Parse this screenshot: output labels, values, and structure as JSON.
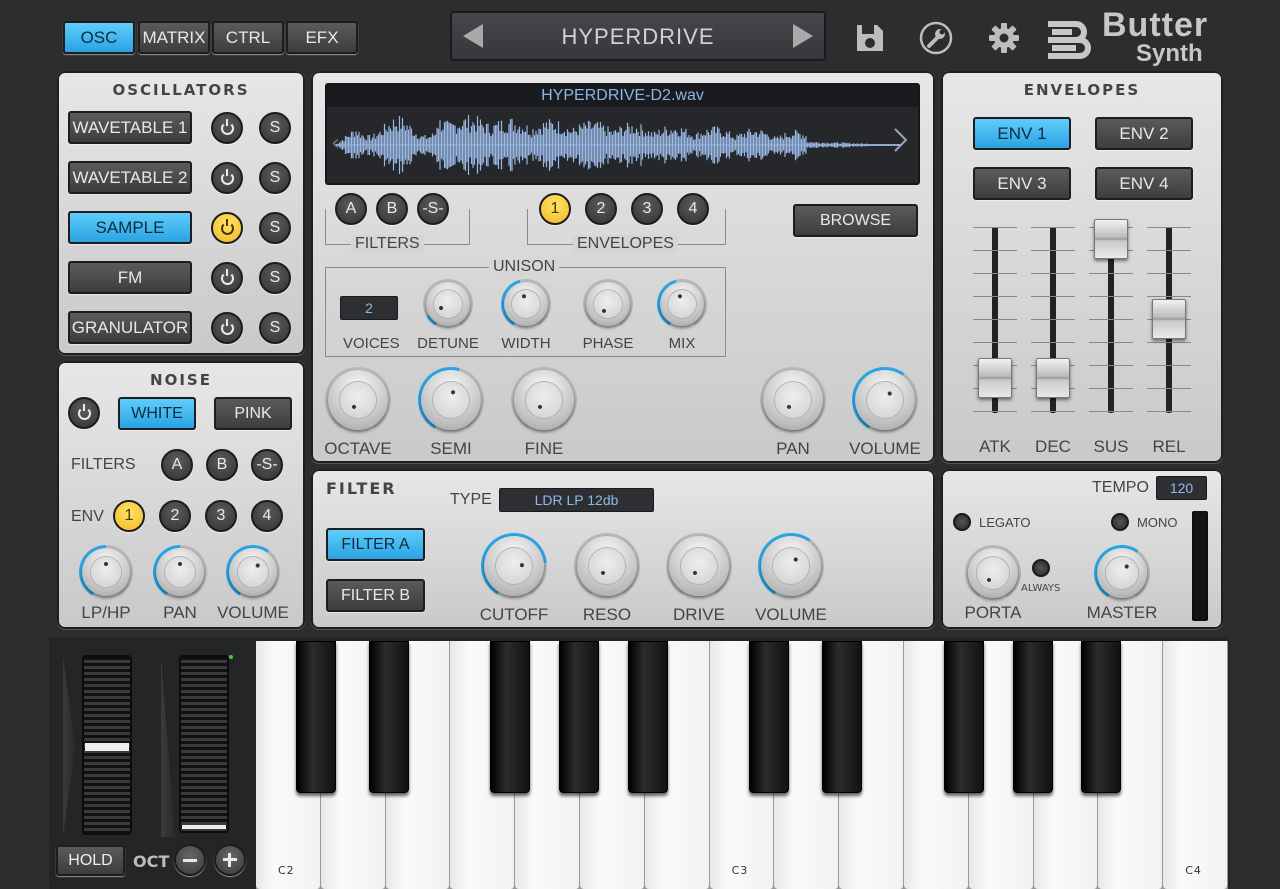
{
  "top": {
    "tabs": [
      "OSC",
      "MATRIX",
      "CTRL",
      "EFX"
    ],
    "preset": "HYPERDRIVE",
    "logo_line1": "Butter",
    "logo_line2": "Synth"
  },
  "oscillators": {
    "title": "OSCILLATORS",
    "items": [
      {
        "label": "WAVETABLE 1",
        "active": false,
        "on": false
      },
      {
        "label": "WAVETABLE 2",
        "active": false,
        "on": false
      },
      {
        "label": "SAMPLE",
        "active": true,
        "on": true
      },
      {
        "label": "FM",
        "active": false,
        "on": false
      },
      {
        "label": "GRANULATOR",
        "active": false,
        "on": false
      }
    ],
    "solo_label": "S"
  },
  "noise": {
    "title": "NOISE",
    "white": "WHITE",
    "pink": "PINK",
    "filters_label": "FILTERS",
    "filter_buttons": [
      "A",
      "B",
      "-S-"
    ],
    "env_label": "ENV",
    "env_buttons": [
      "1",
      "2",
      "3",
      "4"
    ],
    "knobs": [
      {
        "label": "LP/HP",
        "value": 0.5
      },
      {
        "label": "PAN",
        "value": 0.5
      },
      {
        "label": "VOLUME",
        "value": 0.62
      }
    ]
  },
  "sample": {
    "filename": "HYPERDRIVE-D2.wav",
    "filter_buttons": [
      "A",
      "B",
      "-S-"
    ],
    "filters_label": "FILTERS",
    "env_buttons": [
      "1",
      "2",
      "3",
      "4"
    ],
    "envelopes_label": "ENVELOPES",
    "browse": "BROWSE",
    "unison": {
      "title": "UNISON",
      "voices_value": "2",
      "voices_label": "VOICES",
      "knobs": [
        {
          "label": "DETUNE",
          "value": 0.1
        },
        {
          "label": "WIDTH",
          "value": 0.45
        },
        {
          "label": "PHASE",
          "value": 0.0
        },
        {
          "label": "MIX",
          "value": 0.45
        }
      ]
    },
    "knobs": [
      {
        "label": "OCTAVE",
        "value": 0.0
      },
      {
        "label": "SEMI",
        "value": 0.55
      },
      {
        "label": "FINE",
        "value": 0.0
      },
      {
        "label": "PAN",
        "value": 0.0
      },
      {
        "label": "VOLUME",
        "value": 0.62
      }
    ]
  },
  "envelopes": {
    "title": "ENVELOPES",
    "buttons": [
      "ENV 1",
      "ENV 2",
      "ENV 3",
      "ENV 4"
    ],
    "faders": [
      {
        "label": "ATK",
        "value": 0.05
      },
      {
        "label": "DEC",
        "value": 0.05
      },
      {
        "label": "SUS",
        "value": 1.0
      },
      {
        "label": "REL",
        "value": 0.45
      }
    ]
  },
  "filter": {
    "title": "FILTER",
    "type_label": "TYPE",
    "type_value": "LDR LP 12db",
    "filter_a": "FILTER A",
    "filter_b": "FILTER B",
    "knobs": [
      {
        "label": "CUTOFF",
        "value": 0.78
      },
      {
        "label": "RESO",
        "value": 0.0
      },
      {
        "label": "DRIVE",
        "value": 0.0
      },
      {
        "label": "VOLUME",
        "value": 0.62
      }
    ]
  },
  "master": {
    "tempo_label": "TEMPO",
    "tempo_value": "120",
    "legato": "LEGATO",
    "mono": "MONO",
    "always": "ALWAYS",
    "porta_label": "PORTA",
    "porta_value": 0.0,
    "master_label": "MASTER",
    "master_value": 0.62
  },
  "keyboard": {
    "hold": "HOLD",
    "oct": "OCT",
    "notes": [
      "C2",
      "C3",
      "C4"
    ]
  }
}
